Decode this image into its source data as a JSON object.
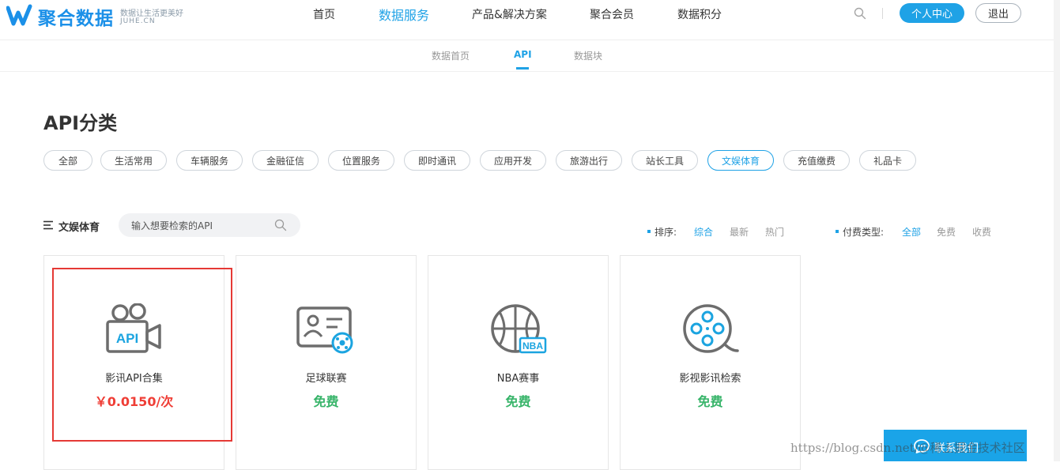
{
  "header": {
    "logo_text": "聚合数据",
    "logo_slogan": "数据让生活更美好",
    "logo_domain": "JUHE.CN",
    "nav": [
      {
        "label": "首页"
      },
      {
        "label": "数据服务",
        "active": true
      },
      {
        "label": "产品&解决方案"
      },
      {
        "label": "聚合会员"
      },
      {
        "label": "数据积分"
      }
    ],
    "personal_center": "个人中心",
    "logout": "退出"
  },
  "subnav": {
    "tabs": [
      {
        "label": "数据首页"
      },
      {
        "label": "API",
        "active": true
      },
      {
        "label": "数据块"
      }
    ]
  },
  "page_title": "API分类",
  "categories": [
    {
      "label": "全部"
    },
    {
      "label": "生活常用"
    },
    {
      "label": "车辆服务"
    },
    {
      "label": "金融征信"
    },
    {
      "label": "位置服务"
    },
    {
      "label": "即时通讯"
    },
    {
      "label": "应用开发"
    },
    {
      "label": "旅游出行"
    },
    {
      "label": "站长工具"
    },
    {
      "label": "文娱体育",
      "active": true
    },
    {
      "label": "充值缴费"
    },
    {
      "label": "礼品卡"
    }
  ],
  "filter": {
    "current_category": "文娱体育",
    "search_placeholder": "输入想要检索的API",
    "sort_label": "排序:",
    "sort_options": [
      {
        "label": "综合",
        "active": true
      },
      {
        "label": "最新"
      },
      {
        "label": "热门"
      }
    ],
    "pay_label": "付费类型:",
    "pay_options": [
      {
        "label": "全部",
        "active": true
      },
      {
        "label": "免费"
      },
      {
        "label": "收费"
      }
    ]
  },
  "cards": [
    {
      "title": "影讯API合集",
      "price": "￥0.0150/次",
      "icon": "movie-camera-api-icon",
      "color": "#ef3e36"
    },
    {
      "title": "足球联赛",
      "price": "免费",
      "icon": "id-card-football-icon",
      "color": "#37b469"
    },
    {
      "title": "NBA赛事",
      "price": "免费",
      "icon": "nba-basketball-icon",
      "color": "#37b469"
    },
    {
      "title": "影视影讯检索",
      "price": "免费",
      "icon": "film-reel-icon",
      "color": "#37b469"
    }
  ],
  "contact": {
    "label": "联系我们"
  },
  "watermark": "https://blog.csdn.net/@稀土掘金技术社区",
  "colors": {
    "accent": "#1fa2e6",
    "paid": "#ef3e36",
    "free": "#37b469",
    "highlight": "#e53935"
  }
}
